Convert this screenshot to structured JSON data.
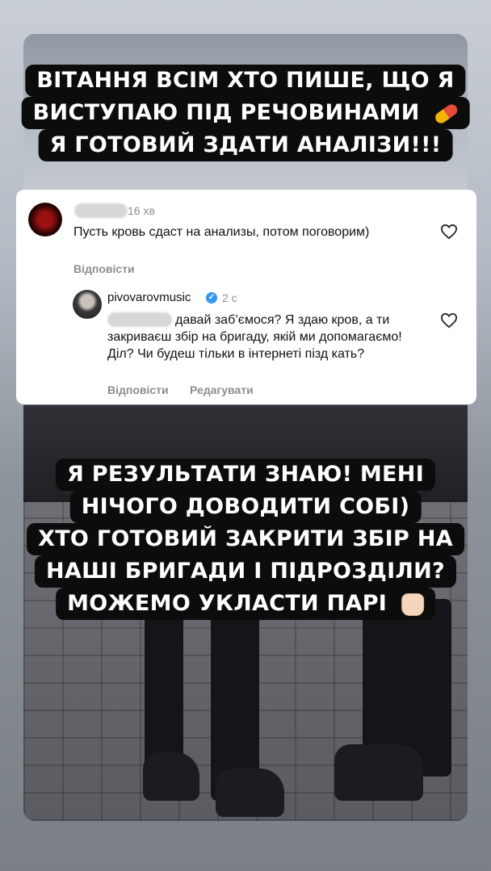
{
  "story": {
    "caption_top": [
      "ВІТАННЯ ВСІМ ХТО ПИШЕ, ЩО Я",
      "ВИСТУПАЮ ПІД РЕЧОВИНАМИ",
      "Я ГОТОВИЙ ЗДАТИ АНАЛІЗИ!!!"
    ],
    "caption_bottom": [
      "Я РЕЗУЛЬТАТИ ЗНАЮ! МЕНІ",
      "НІЧОГО ДОВОДИТИ СОБІ)",
      "ХТО ГОТОВИЙ ЗАКРИТИ ЗБІР НА",
      "НАШІ БРИГАДИ І ПІДРОЗДІЛИ?",
      "МОЖЕМО УКЛАСТИ ПАРІ"
    ],
    "emoji": {
      "pill": "pill-emoji",
      "fist": "raised-fist-emoji"
    }
  },
  "comments": [
    {
      "time": "16 хв",
      "text": "Пусть кровь сдаст на анализы, потом поговорим)",
      "reply_label": "Відповісти",
      "icon": "heart-icon"
    },
    {
      "username": "pivovarovmusic",
      "time": "2 с",
      "text": "давай заб’ємося? Я здаю кров, а ти закриваєш збір на бригаду, якій ми допомагаємо! Діл? Чи будеш тільки в інтернеті пізд  кать?",
      "reply_label": "Відповісти",
      "edit_label": "Редагувати",
      "icon": "heart-icon"
    }
  ],
  "colors": {
    "caption_bg": "#0c0c0d",
    "caption_text": "#ffffff",
    "verified": "#3897f0",
    "muted": "#8e8e8e"
  }
}
